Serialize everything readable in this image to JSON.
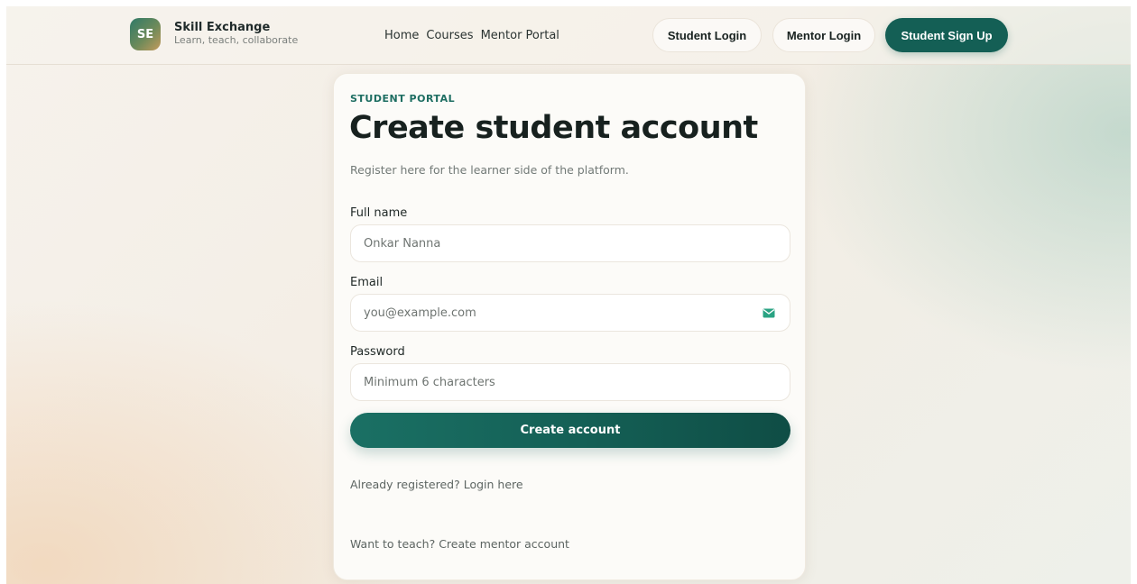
{
  "header": {
    "logo_initials": "SE",
    "brand_name": "Skill Exchange",
    "brand_tagline": "Learn, teach, collaborate",
    "nav": {
      "home": "Home",
      "courses": "Courses",
      "mentor_portal": "Mentor Portal"
    },
    "buttons": {
      "student_login": "Student Login",
      "mentor_login": "Mentor Login",
      "student_signup": "Student Sign Up"
    }
  },
  "form": {
    "eyebrow": "STUDENT PORTAL",
    "title": "Create student account",
    "subtitle": "Register here for the learner side of the platform.",
    "fields": {
      "full_name": {
        "label": "Full name",
        "placeholder": "Onkar Nanna"
      },
      "email": {
        "label": "Email",
        "placeholder": "you@example.com",
        "icon": "mail-icon"
      },
      "password": {
        "label": "Password",
        "placeholder": "Minimum 6 characters"
      }
    },
    "submit_label": "Create account",
    "login_link": "Already registered? Login here",
    "mentor_link": "Want to teach? Create mentor account"
  },
  "colors": {
    "accent": "#145f55",
    "eyebrow": "#1e6e62",
    "background": "#f5f0e8"
  }
}
